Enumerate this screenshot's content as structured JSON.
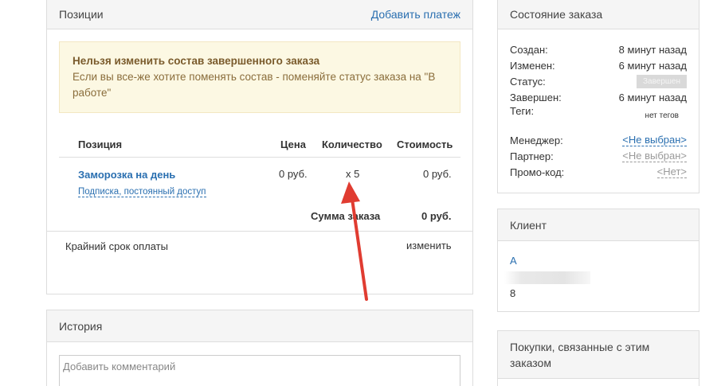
{
  "positions": {
    "title": "Позиции",
    "add_payment": "Добавить платеж",
    "alert": {
      "title": "Нельзя изменить состав завершенного заказа",
      "body": "Если вы все-же хотите поменять состав - поменяйте статус заказа на \"В работе\""
    },
    "columns": [
      "Позиция",
      "Цена",
      "Количество",
      "Стоимость"
    ],
    "items": [
      {
        "name": "Заморозка на день",
        "subtitle": "Подписка, постоянный доступ",
        "price": "0 руб.",
        "quantity": "x 5",
        "cost": "0 руб."
      }
    ],
    "total_label": "Сумма заказа",
    "total_value": "0 руб.",
    "deadline_label": "Крайний срок оплаты",
    "deadline_action": "изменить"
  },
  "history": {
    "title": "История",
    "comment_placeholder": "Добавить комментарий"
  },
  "status": {
    "title": "Состояние заказа",
    "created_label": "Создан:",
    "created_value": "8 минут назад",
    "changed_label": "Изменен:",
    "changed_value": "6 минут назад",
    "status_label": "Статус:",
    "status_value": "Завершен",
    "completed_label": "Завершен:",
    "completed_value": "6 минут назад",
    "tags_label": "Теги:",
    "tags_value": "нет тегов",
    "manager_label": "Менеджер:",
    "manager_value": "<Не выбран>",
    "partner_label": "Партнер:",
    "partner_value": "<Не выбран>",
    "promo_label": "Промо-код:",
    "promo_value": "<Нет>"
  },
  "client": {
    "title": "Клиент",
    "name": "А",
    "extra": "8"
  },
  "related": {
    "title": "Покупки, связанные с этим заказом"
  },
  "colors": {
    "link": "#2a6fb0",
    "alert_bg": "#fcf8e3",
    "arrow": "#e03c31",
    "badge": "#d9d9d9"
  }
}
